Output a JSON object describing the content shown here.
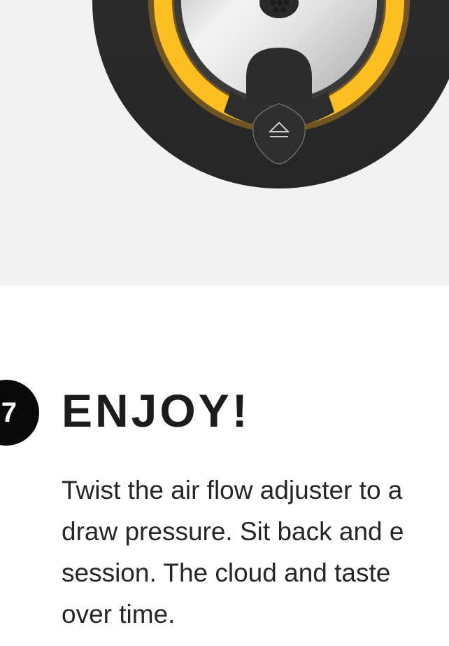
{
  "step": {
    "number": "7",
    "title": "ENJOY!",
    "body_lines": [
      "Twist the air flow adjuster to a",
      "draw pressure. Sit back and e",
      "session. The cloud and taste",
      "over time."
    ]
  },
  "colors": {
    "hero_background": "#f2f2f2",
    "device_body": "#2b2b2b",
    "led_ring": "#f5b31c",
    "badge": "#0a0a0a",
    "title": "#1c1c1c",
    "body_text": "#262626"
  },
  "icons": {
    "eject": "eject-icon"
  }
}
